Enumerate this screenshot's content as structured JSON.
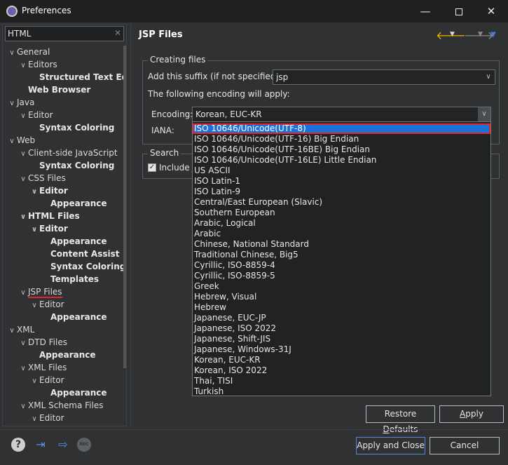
{
  "window": {
    "title": "Preferences",
    "minimize": "—",
    "close": "✕"
  },
  "filter": {
    "value": "HTML",
    "clear": "✕"
  },
  "tree": [
    {
      "label": "General",
      "twisty": "∨",
      "bold": false
    },
    {
      "label": "Editors",
      "twisty": "∨",
      "bold": false
    },
    {
      "label": "Structured Text Ed",
      "twisty": "",
      "bold": true
    },
    {
      "label": "Web Browser",
      "twisty": "",
      "bold": true
    },
    {
      "label": "Java",
      "twisty": "∨",
      "bold": false
    },
    {
      "label": "Editor",
      "twisty": "∨",
      "bold": false
    },
    {
      "label": "Syntax Coloring",
      "twisty": "",
      "bold": true
    },
    {
      "label": "Web",
      "twisty": "∨",
      "bold": false
    },
    {
      "label": "Client-side JavaScript",
      "twisty": "∨",
      "bold": false
    },
    {
      "label": "Syntax Coloring",
      "twisty": "",
      "bold": true
    },
    {
      "label": "CSS Files",
      "twisty": "∨",
      "bold": false
    },
    {
      "label": "Editor",
      "twisty": "∨",
      "bold": true
    },
    {
      "label": "Appearance",
      "twisty": "",
      "bold": true
    },
    {
      "label": "HTML Files",
      "twisty": "∨",
      "bold": true
    },
    {
      "label": "Editor",
      "twisty": "∨",
      "bold": true
    },
    {
      "label": "Appearance",
      "twisty": "",
      "bold": true
    },
    {
      "label": "Content Assist",
      "twisty": "",
      "bold": true
    },
    {
      "label": "Syntax Coloring",
      "twisty": "",
      "bold": true
    },
    {
      "label": "Templates",
      "twisty": "",
      "bold": true
    },
    {
      "label": "JSP Files",
      "twisty": "∨",
      "bold": false,
      "selected": true
    },
    {
      "label": "Editor",
      "twisty": "∨",
      "bold": false
    },
    {
      "label": "Appearance",
      "twisty": "",
      "bold": true
    },
    {
      "label": "XML",
      "twisty": "∨",
      "bold": false
    },
    {
      "label": "DTD Files",
      "twisty": "∨",
      "bold": false
    },
    {
      "label": "Appearance",
      "twisty": "",
      "bold": true
    },
    {
      "label": "XML Files",
      "twisty": "∨",
      "bold": false
    },
    {
      "label": "Editor",
      "twisty": "∨",
      "bold": false
    },
    {
      "label": "Appearance",
      "twisty": "",
      "bold": true
    },
    {
      "label": "XML Schema Files",
      "twisty": "∨",
      "bold": false
    },
    {
      "label": "Editor",
      "twisty": "∨",
      "bold": false
    }
  ],
  "page": {
    "title": "JSP Files",
    "back_icon": "🡐",
    "forward_icon": "🡒",
    "dropdown_glyph": "▼",
    "menu_glyph": "▼"
  },
  "creating_files": {
    "legend": "Creating files",
    "suffix_label": "Add this suffix (if not specified):",
    "suffix_value": "jsp",
    "encoding_note": "The following encoding will apply:",
    "encoding_label": "Encoding:",
    "encoding_value": "Korean, EUC-KR",
    "iana_label": "IANA:"
  },
  "search": {
    "legend": "Search",
    "include_label": "Include J",
    "checked": true
  },
  "encoding_options": [
    "ISO 10646/Unicode(UTF-8)",
    "ISO 10646/Unicode(UTF-16) Big Endian",
    "ISO 10646/Unicode(UTF-16BE) Big Endian",
    "ISO 10646/Unicode(UTF-16LE) Little Endian",
    "US ASCII",
    "ISO Latin-1",
    "ISO Latin-9",
    "Central/East European (Slavic)",
    "Southern European",
    "Arabic, Logical",
    "Arabic",
    "Chinese, National Standard",
    "Traditional Chinese, Big5",
    "Cyrillic, ISO-8859-4",
    "Cyrillic, ISO-8859-5",
    "Greek",
    "Hebrew, Visual",
    "Hebrew",
    "Japanese, EUC-JP",
    "Japanese, ISO 2022",
    "Japanese, Shift-JIS",
    "Japanese, Windows-31J",
    "Korean, EUC-KR",
    "Korean, ISO 2022",
    "Thai, TISI",
    "Turkish"
  ],
  "highlighted_option": 0,
  "buttons": {
    "restore_pre": "Restore ",
    "restore_u": "D",
    "restore_post": "efaults",
    "apply_u": "A",
    "apply_post": "pply",
    "apply_close": "Apply and Close",
    "cancel": "Cancel"
  },
  "bottom_icons": {
    "help": "?",
    "import": "⇥",
    "export": "⇨",
    "rec": "REC"
  },
  "colors": {
    "selection": "#1a73d9",
    "annotation_red": "#e0262c",
    "accent_blue": "#5a8de8",
    "nav_yellow": "#f2b400"
  }
}
